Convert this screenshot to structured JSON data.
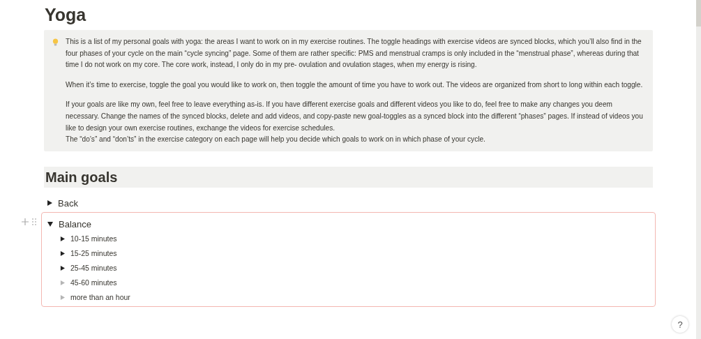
{
  "title": "Yoga",
  "callout": {
    "paragraphs": [
      "This is a list of my personal goals with yoga: the areas I want to work on in my exercise routines. The toggle headings with exercise videos are synced blocks, which you’ll also find in the four phases of your cycle on the main “cycle syncing” page. Some of them are rather specific: PMS and menstrual cramps is only included in the “menstrual phase”, whereas during that time I do not work on my core. The core work, instead, I only do in my pre- ovulation and ovulation stages, when my energy is rising.",
      "When it’s time to exercise, toggle the goal you would like to work on, then toggle the amount of time you have to work out. The videos are organized from short to long within each toggle.",
      "If your goals are like my own, feel free to leave everything as-is. If you have different exercise goals and different videos you like to do, feel free to make any changes you deem necessary. Change the names of the synced blocks, delete and add videos, and copy-paste new goal-toggles as a synced block into the different “phases” pages. If instead of videos you like to design your own exercise routines, exchange the videos for exercise schedules.\nThe “do’s” and “don’ts” in the exercise category on each page will help you decide which goals to work on in which phase of your cycle."
    ]
  },
  "section_heading": "Main goals",
  "toggles": [
    {
      "label": "Back",
      "expanded": false,
      "synced": false
    },
    {
      "label": "Balance",
      "expanded": true,
      "synced": true,
      "children": [
        {
          "label": "10-15 minutes",
          "has_content": true
        },
        {
          "label": "15-25 minutes",
          "has_content": true
        },
        {
          "label": "25-45 minutes",
          "has_content": true
        },
        {
          "label": "45-60 minutes",
          "has_content": false
        },
        {
          "label": "more than an hour",
          "has_content": false
        }
      ]
    }
  ],
  "help_button": "?"
}
